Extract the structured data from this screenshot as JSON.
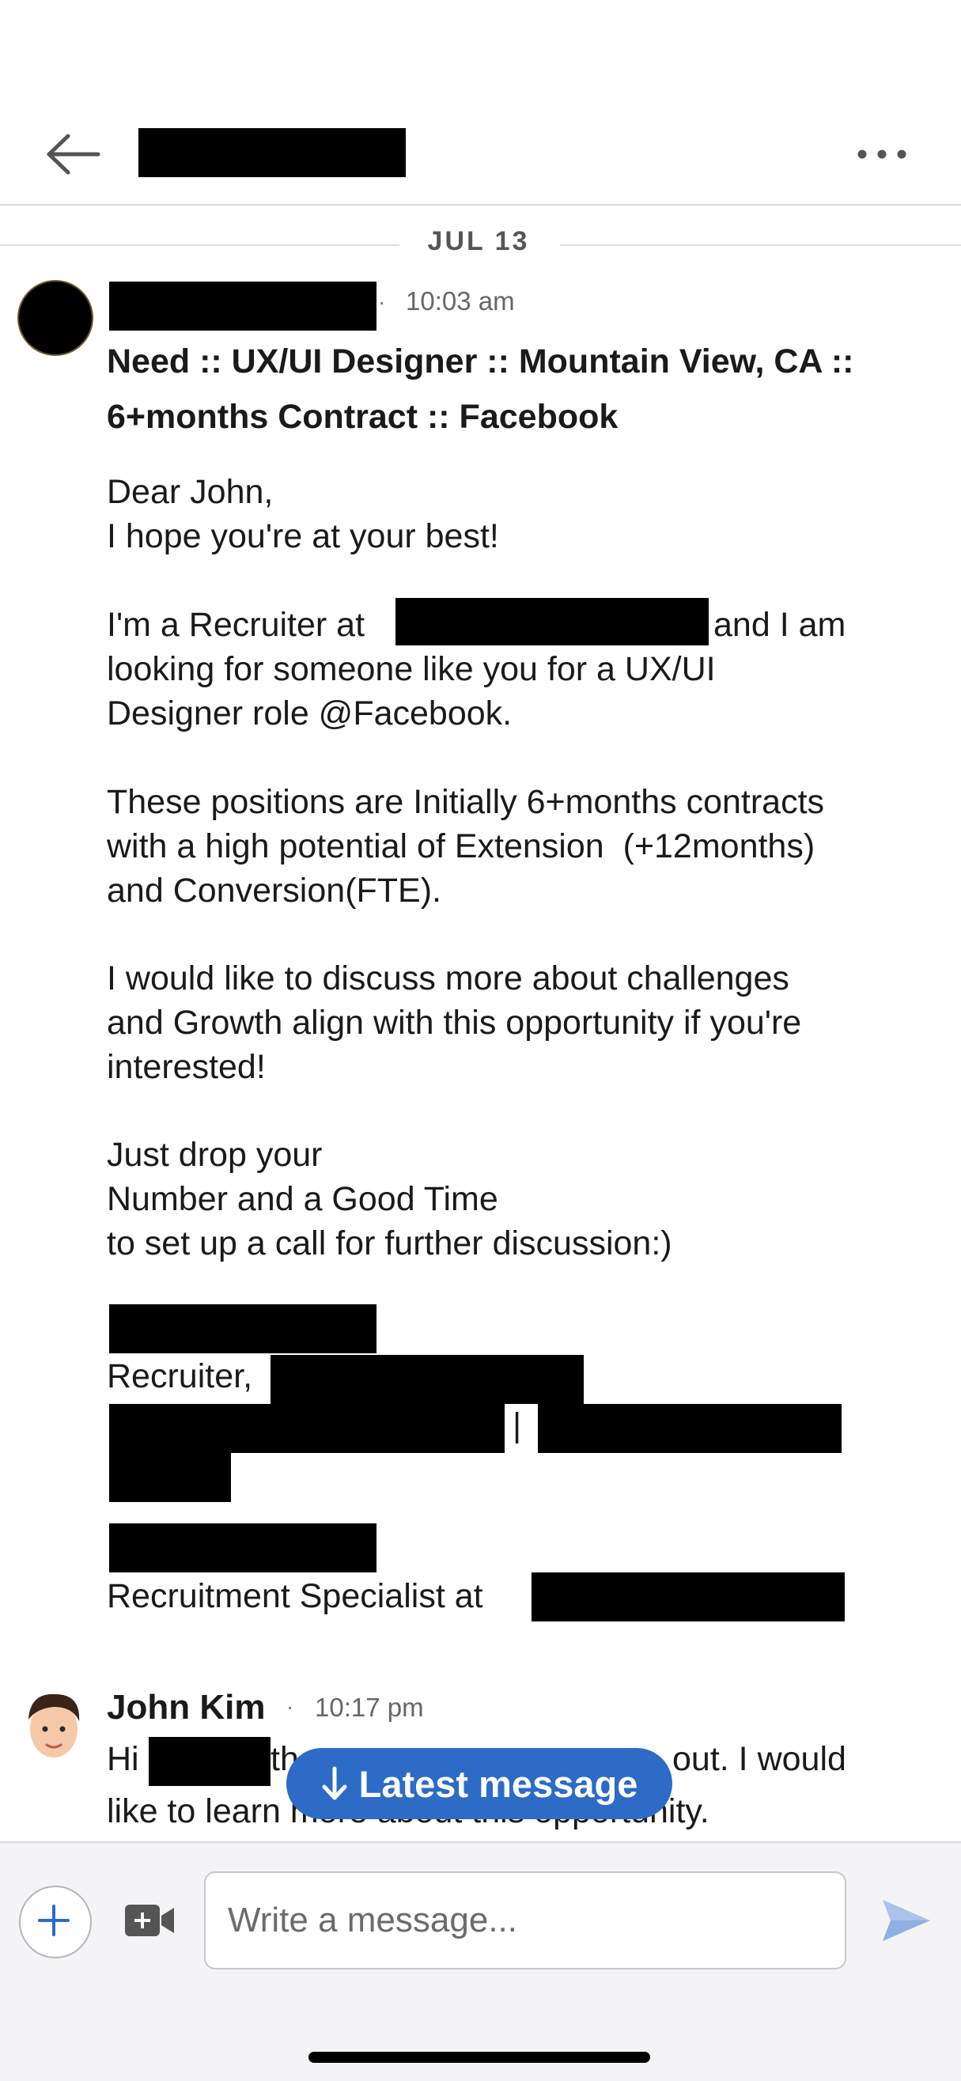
{
  "header": {
    "back_icon": "arrow-left-icon",
    "more_icon": "more-horizontal-icon"
  },
  "date_divider": "JUL 13",
  "messages": [
    {
      "time": "10:03 am",
      "subject": "Need :: UX/UI Designer :: Mountain View, CA :: 6+months Contract :: Facebook",
      "subject_lines": [
        "Need :: UX/UI Designer :: Mountain View, CA ::",
        "6+months Contract :: Facebook"
      ],
      "body": {
        "greeting": "Dear John,",
        "line2": "I hope you're at your best!",
        "p2_a": "I'm a Recruiter at",
        "p2_b": "and I am",
        "p2_c": "looking for someone like you for a UX/UI",
        "p2_d": "Designer role @Facebook.",
        "p3": "These positions are Initially 6+months contracts\nwith a high potential of Extension  (+12months)\nand Conversion(FTE).",
        "p4": "I would like to discuss more about challenges\nand Growth align with this opportunity if you're\ninterested!",
        "p5": "Just drop your\nNumber and a Good Time\nto set up a call for further discussion:)",
        "sig_title": "Recruiter,",
        "sig_sep": "|",
        "sig_role": "Recruitment Specialist at"
      }
    },
    {
      "sender": "John Kim",
      "time": "10:17 pm",
      "line1_a": "Hi",
      "line1_b": "tha",
      "line1_c": "out. I would",
      "line2": "like to learn more about this opportunity."
    }
  ],
  "latest_button": "Latest message",
  "composer": {
    "placeholder": "Write a message...",
    "plus_icon": "plus-icon",
    "video_icon": "video-camera-icon",
    "send_icon": "send-icon"
  },
  "colors": {
    "accent": "#2c6bc6",
    "divider": "#dcdcdc",
    "composer_bg": "#f4f4f7",
    "redaction": "#000000"
  }
}
